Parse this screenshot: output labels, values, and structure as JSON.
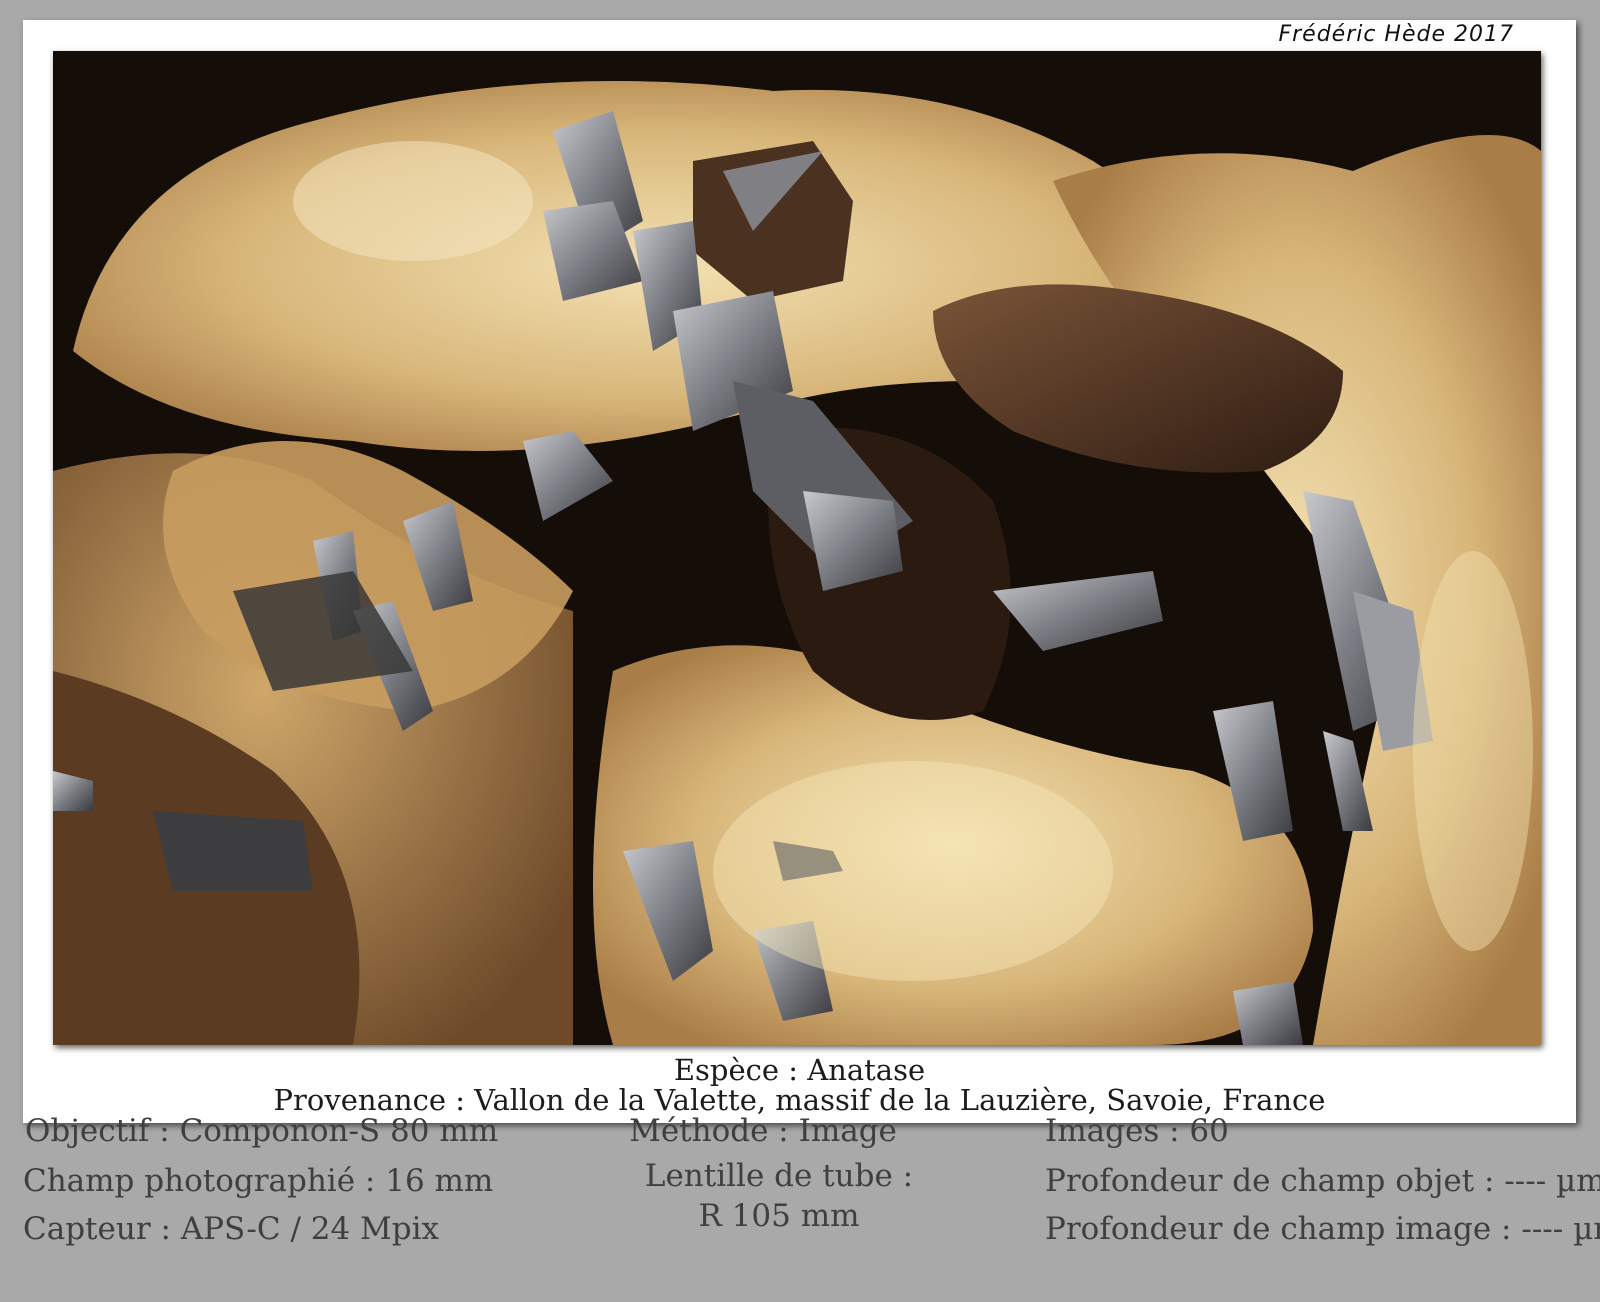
{
  "signature": "Frédéric Hède 2017",
  "photo": {
    "subject": "mineral-specimen-photo",
    "palette": {
      "background": "#1a120c",
      "matrix_light": "#e8cf9c",
      "matrix_mid": "#c49a5e",
      "matrix_dark": "#5a3a22",
      "crystal_steel": "#8e9096",
      "crystal_dark": "#3c3a3c"
    }
  },
  "caption": {
    "species": "Espèce : Anatase",
    "origin": "Provenance : Vallon de la Valette, massif de la Lauzière, Savoie, France"
  },
  "info": {
    "objective": "Objectif : Componon-S 80 mm",
    "field": "Champ photographié : 16 mm",
    "sensor": "Capteur : APS-C / 24 Mpix",
    "method": "Méthode : Image",
    "tube_lens_label": "Lentille de tube :",
    "tube_lens_value": "R 105 mm",
    "images": "Images : 60",
    "dof_object": "Profondeur de champ objet : ---- µm",
    "dof_image": "Profondeur de champ image : ---- µm"
  }
}
